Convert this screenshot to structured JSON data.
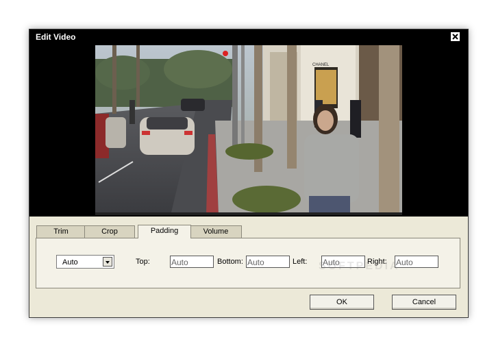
{
  "window": {
    "title": "Edit Video"
  },
  "video": {
    "storefront_sign": "CHANEL"
  },
  "tabs": [
    {
      "label": "Trim"
    },
    {
      "label": "Crop"
    },
    {
      "label": "Padding",
      "active": true
    },
    {
      "label": "Volume"
    }
  ],
  "padding": {
    "mode_select": "Auto",
    "top_label": "Top:",
    "top_value": "Auto",
    "bottom_label": "Bottom:",
    "bottom_value": "Auto",
    "left_label": "Left:",
    "left_value": "Auto",
    "right_label": "Right:",
    "right_value": "Auto"
  },
  "buttons": {
    "ok": "OK",
    "cancel": "Cancel"
  },
  "watermark": "SOFTPEDIA",
  "icons": {
    "close": "close-icon",
    "dropdown": "chevron-down-icon"
  }
}
